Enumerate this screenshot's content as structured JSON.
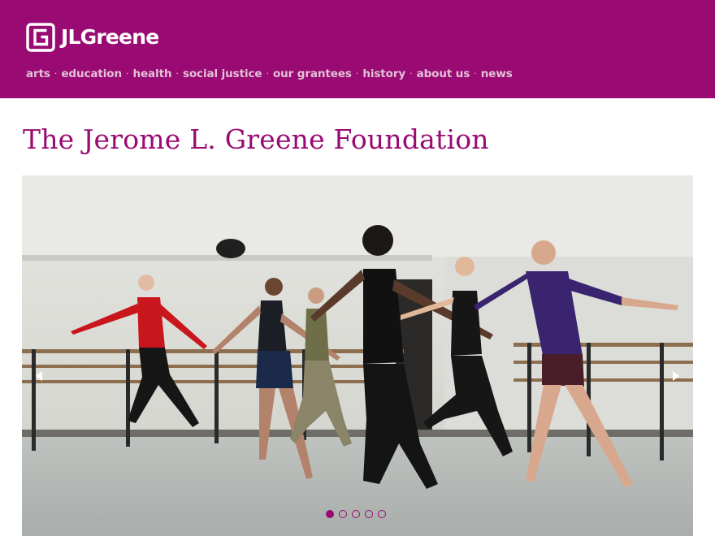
{
  "site": {
    "logo_text": "JLGreene",
    "logo_icon": "jlg-mark-icon",
    "brand_color": "#990a72"
  },
  "nav": {
    "items": [
      {
        "label": "arts"
      },
      {
        "label": "education"
      },
      {
        "label": "health"
      },
      {
        "label": "social justice"
      },
      {
        "label": "our grantees"
      },
      {
        "label": "history"
      },
      {
        "label": "about us"
      },
      {
        "label": "news"
      }
    ],
    "separator": "·"
  },
  "main": {
    "title": "The Jerome L. Greene Foundation"
  },
  "slider": {
    "image": "dancers-rehearsal-studio-photo",
    "prev_icon": "chevron-left-icon",
    "next_icon": "chevron-right-icon",
    "slide_count": 5,
    "active_slide": 1
  }
}
